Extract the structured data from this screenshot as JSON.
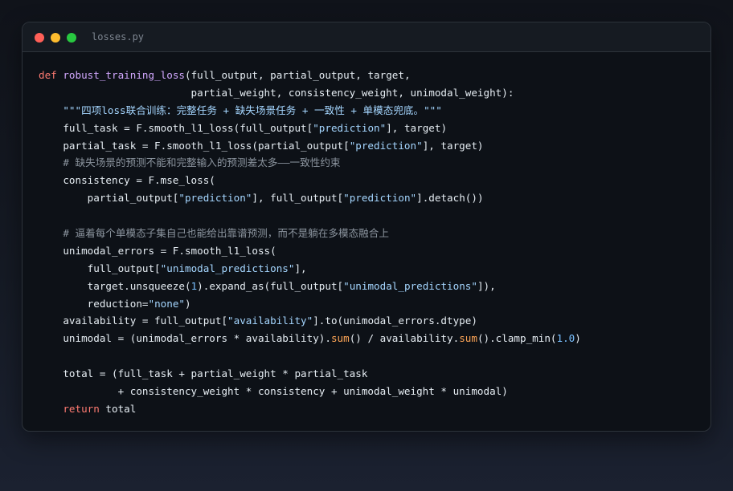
{
  "window": {
    "filename": "losses.py"
  },
  "code": {
    "lines": [
      [
        {
          "t": "def",
          "c": "kw"
        },
        {
          "t": " "
        },
        {
          "t": "robust_training_loss",
          "c": "fn"
        },
        {
          "t": "(full_output, partial_output, target,"
        }
      ],
      [
        {
          "t": "                         partial_weight, consistency_weight, unimodal_weight):"
        }
      ],
      [
        {
          "t": "    "
        },
        {
          "t": "\"\"\"四项loss联合训练：完整任务 + 缺失场景任务 + 一致性 + 单模态兜底。\"\"\"",
          "c": "str"
        }
      ],
      [
        {
          "t": "    full_task = F.smooth_l1_loss(full_output["
        },
        {
          "t": "\"prediction\"",
          "c": "str"
        },
        {
          "t": "], target)"
        }
      ],
      [
        {
          "t": "    partial_task = F.smooth_l1_loss(partial_output["
        },
        {
          "t": "\"prediction\"",
          "c": "str"
        },
        {
          "t": "], target)"
        }
      ],
      [
        {
          "t": "    "
        },
        {
          "t": "# 缺失场景的预测不能和完整输入的预测差太多——一致性约束",
          "c": "cm"
        }
      ],
      [
        {
          "t": "    consistency = F.mse_loss("
        }
      ],
      [
        {
          "t": "        partial_output["
        },
        {
          "t": "\"prediction\"",
          "c": "str"
        },
        {
          "t": "], full_output["
        },
        {
          "t": "\"prediction\"",
          "c": "str"
        },
        {
          "t": "].detach())"
        }
      ],
      [],
      [
        {
          "t": "    "
        },
        {
          "t": "# 逼着每个单模态子集自己也能给出靠谱预测，而不是躺在多模态融合上",
          "c": "cm"
        }
      ],
      [
        {
          "t": "    unimodal_errors = F.smooth_l1_loss("
        }
      ],
      [
        {
          "t": "        full_output["
        },
        {
          "t": "\"unimodal_predictions\"",
          "c": "str"
        },
        {
          "t": "],"
        }
      ],
      [
        {
          "t": "        target.unsqueeze("
        },
        {
          "t": "1",
          "c": "num"
        },
        {
          "t": ").expand_as(full_output["
        },
        {
          "t": "\"unimodal_predictions\"",
          "c": "str"
        },
        {
          "t": "]),"
        }
      ],
      [
        {
          "t": "        reduction="
        },
        {
          "t": "\"none\"",
          "c": "str"
        },
        {
          "t": ")"
        }
      ],
      [
        {
          "t": "    availability = full_output["
        },
        {
          "t": "\"availability\"",
          "c": "str"
        },
        {
          "t": "].to(unimodal_errors.dtype)"
        }
      ],
      [
        {
          "t": "    unimodal = (unimodal_errors * availability)."
        },
        {
          "t": "sum",
          "c": "bi"
        },
        {
          "t": "() / availability."
        },
        {
          "t": "sum",
          "c": "bi"
        },
        {
          "t": "().clamp_min("
        },
        {
          "t": "1.0",
          "c": "num"
        },
        {
          "t": ")"
        }
      ],
      [],
      [
        {
          "t": "    total = (full_task + partial_weight * partial_task"
        }
      ],
      [
        {
          "t": "             + consistency_weight * consistency + unimodal_weight * unimodal)"
        }
      ],
      [
        {
          "t": "    "
        },
        {
          "t": "return",
          "c": "kw"
        },
        {
          "t": " total"
        }
      ]
    ]
  },
  "colors": {
    "keyword": "#ff7b72",
    "function": "#d2a8ff",
    "string": "#a5d6ff",
    "comment": "#8b949e",
    "number": "#79c0ff",
    "builtin": "#ffa657",
    "text": "#e6edf3",
    "background": "#0d1117"
  }
}
